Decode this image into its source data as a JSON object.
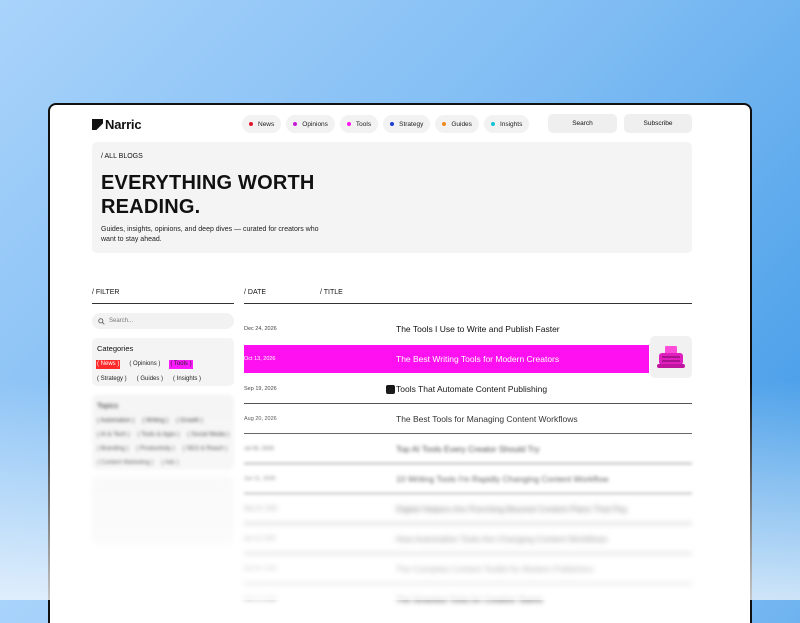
{
  "brand": {
    "name": "Narric"
  },
  "nav": {
    "items": [
      {
        "label": "News",
        "color": "#e0162b"
      },
      {
        "label": "Opinions",
        "color": "#c21bd6"
      },
      {
        "label": "Tools",
        "color": "#ff14f0"
      },
      {
        "label": "Strategy",
        "color": "#1f3fd1"
      },
      {
        "label": "Guides",
        "color": "#f08a1a"
      },
      {
        "label": "Insights",
        "color": "#19c3d6"
      }
    ],
    "search_label": "Search",
    "subscribe_label": "Subscribe"
  },
  "hero": {
    "breadcrumb": "/ ALL BLOGS",
    "title": "EVERYTHING WORTH READING.",
    "subtitle": "Guides, insights, opinions, and deep dives — curated for creators who want to stay ahead."
  },
  "filter": {
    "label": "/ FILTER",
    "search_placeholder": "Search...",
    "categories_title": "Categories",
    "categories": [
      {
        "label": "( News )",
        "state": "red"
      },
      {
        "label": "( Opinions )",
        "state": "normal"
      },
      {
        "label": "( Tools )",
        "state": "active"
      },
      {
        "label": "( Strategy )",
        "state": "normal"
      },
      {
        "label": "( Guides )",
        "state": "normal"
      },
      {
        "label": "( Insights )",
        "state": "normal"
      }
    ],
    "topics_title": "Topics",
    "topics": [
      "( Automation )",
      "( Writing )",
      "( Growth )",
      "( AI & Tech )",
      "( Tools & Apps )",
      "( Social Media )",
      "( Branding )",
      "( Productivity )",
      "( SEO & Reach )",
      "( Content Marketing )",
      "( Ads )"
    ]
  },
  "table": {
    "date_header": "/ DATE",
    "title_header": "/ TITLE",
    "rows": [
      {
        "date": "Dec 24, 2026",
        "title": "The Tools I Use to Write and Publish Faster"
      },
      {
        "date": "Oct 13, 2026",
        "title": "The Best Writing Tools for Modern Creators"
      },
      {
        "date": "Sep 19, 2026",
        "title": "Tools That Automate Content Publishing"
      },
      {
        "date": "Aug 20, 2026",
        "title": "The Best Tools for Managing Content Workflows"
      },
      {
        "date": "Jul 05, 2026",
        "title": "Top AI Tools Every Creator Should Try"
      },
      {
        "date": "Jun 11, 2026",
        "title": "10 Writing Tools I'm Rapidly Changing Content Workflow"
      },
      {
        "date": "May 02, 2026",
        "title": "Digital Helpers Are Punching Beyond Content Plans That Pay"
      },
      {
        "date": "Apr 18, 2026",
        "title": "How Automation Tools Are Changing Content Workflows"
      },
      {
        "date": "Mar 09, 2026",
        "title": "The Complete Content Toolkit for Modern Publishers"
      },
      {
        "date": "Feb 14, 2026",
        "title": "The Smartest Tools for Creative Teams"
      }
    ]
  }
}
